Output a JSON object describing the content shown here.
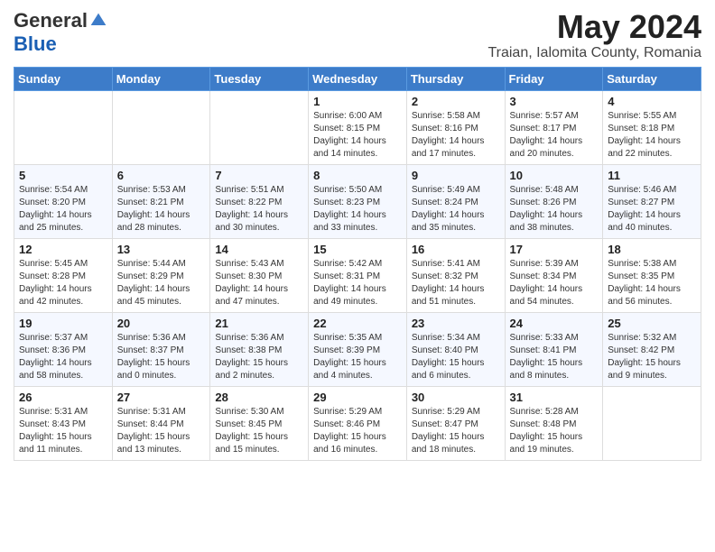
{
  "logo": {
    "general": "General",
    "blue": "Blue"
  },
  "title": "May 2024",
  "location": "Traian, Ialomita County, Romania",
  "days_of_week": [
    "Sunday",
    "Monday",
    "Tuesday",
    "Wednesday",
    "Thursday",
    "Friday",
    "Saturday"
  ],
  "weeks": [
    [
      {
        "day": "",
        "detail": ""
      },
      {
        "day": "",
        "detail": ""
      },
      {
        "day": "",
        "detail": ""
      },
      {
        "day": "1",
        "detail": "Sunrise: 6:00 AM\nSunset: 8:15 PM\nDaylight: 14 hours\nand 14 minutes."
      },
      {
        "day": "2",
        "detail": "Sunrise: 5:58 AM\nSunset: 8:16 PM\nDaylight: 14 hours\nand 17 minutes."
      },
      {
        "day": "3",
        "detail": "Sunrise: 5:57 AM\nSunset: 8:17 PM\nDaylight: 14 hours\nand 20 minutes."
      },
      {
        "day": "4",
        "detail": "Sunrise: 5:55 AM\nSunset: 8:18 PM\nDaylight: 14 hours\nand 22 minutes."
      }
    ],
    [
      {
        "day": "5",
        "detail": "Sunrise: 5:54 AM\nSunset: 8:20 PM\nDaylight: 14 hours\nand 25 minutes."
      },
      {
        "day": "6",
        "detail": "Sunrise: 5:53 AM\nSunset: 8:21 PM\nDaylight: 14 hours\nand 28 minutes."
      },
      {
        "day": "7",
        "detail": "Sunrise: 5:51 AM\nSunset: 8:22 PM\nDaylight: 14 hours\nand 30 minutes."
      },
      {
        "day": "8",
        "detail": "Sunrise: 5:50 AM\nSunset: 8:23 PM\nDaylight: 14 hours\nand 33 minutes."
      },
      {
        "day": "9",
        "detail": "Sunrise: 5:49 AM\nSunset: 8:24 PM\nDaylight: 14 hours\nand 35 minutes."
      },
      {
        "day": "10",
        "detail": "Sunrise: 5:48 AM\nSunset: 8:26 PM\nDaylight: 14 hours\nand 38 minutes."
      },
      {
        "day": "11",
        "detail": "Sunrise: 5:46 AM\nSunset: 8:27 PM\nDaylight: 14 hours\nand 40 minutes."
      }
    ],
    [
      {
        "day": "12",
        "detail": "Sunrise: 5:45 AM\nSunset: 8:28 PM\nDaylight: 14 hours\nand 42 minutes."
      },
      {
        "day": "13",
        "detail": "Sunrise: 5:44 AM\nSunset: 8:29 PM\nDaylight: 14 hours\nand 45 minutes."
      },
      {
        "day": "14",
        "detail": "Sunrise: 5:43 AM\nSunset: 8:30 PM\nDaylight: 14 hours\nand 47 minutes."
      },
      {
        "day": "15",
        "detail": "Sunrise: 5:42 AM\nSunset: 8:31 PM\nDaylight: 14 hours\nand 49 minutes."
      },
      {
        "day": "16",
        "detail": "Sunrise: 5:41 AM\nSunset: 8:32 PM\nDaylight: 14 hours\nand 51 minutes."
      },
      {
        "day": "17",
        "detail": "Sunrise: 5:39 AM\nSunset: 8:34 PM\nDaylight: 14 hours\nand 54 minutes."
      },
      {
        "day": "18",
        "detail": "Sunrise: 5:38 AM\nSunset: 8:35 PM\nDaylight: 14 hours\nand 56 minutes."
      }
    ],
    [
      {
        "day": "19",
        "detail": "Sunrise: 5:37 AM\nSunset: 8:36 PM\nDaylight: 14 hours\nand 58 minutes."
      },
      {
        "day": "20",
        "detail": "Sunrise: 5:36 AM\nSunset: 8:37 PM\nDaylight: 15 hours\nand 0 minutes."
      },
      {
        "day": "21",
        "detail": "Sunrise: 5:36 AM\nSunset: 8:38 PM\nDaylight: 15 hours\nand 2 minutes."
      },
      {
        "day": "22",
        "detail": "Sunrise: 5:35 AM\nSunset: 8:39 PM\nDaylight: 15 hours\nand 4 minutes."
      },
      {
        "day": "23",
        "detail": "Sunrise: 5:34 AM\nSunset: 8:40 PM\nDaylight: 15 hours\nand 6 minutes."
      },
      {
        "day": "24",
        "detail": "Sunrise: 5:33 AM\nSunset: 8:41 PM\nDaylight: 15 hours\nand 8 minutes."
      },
      {
        "day": "25",
        "detail": "Sunrise: 5:32 AM\nSunset: 8:42 PM\nDaylight: 15 hours\nand 9 minutes."
      }
    ],
    [
      {
        "day": "26",
        "detail": "Sunrise: 5:31 AM\nSunset: 8:43 PM\nDaylight: 15 hours\nand 11 minutes."
      },
      {
        "day": "27",
        "detail": "Sunrise: 5:31 AM\nSunset: 8:44 PM\nDaylight: 15 hours\nand 13 minutes."
      },
      {
        "day": "28",
        "detail": "Sunrise: 5:30 AM\nSunset: 8:45 PM\nDaylight: 15 hours\nand 15 minutes."
      },
      {
        "day": "29",
        "detail": "Sunrise: 5:29 AM\nSunset: 8:46 PM\nDaylight: 15 hours\nand 16 minutes."
      },
      {
        "day": "30",
        "detail": "Sunrise: 5:29 AM\nSunset: 8:47 PM\nDaylight: 15 hours\nand 18 minutes."
      },
      {
        "day": "31",
        "detail": "Sunrise: 5:28 AM\nSunset: 8:48 PM\nDaylight: 15 hours\nand 19 minutes."
      },
      {
        "day": "",
        "detail": ""
      }
    ]
  ]
}
